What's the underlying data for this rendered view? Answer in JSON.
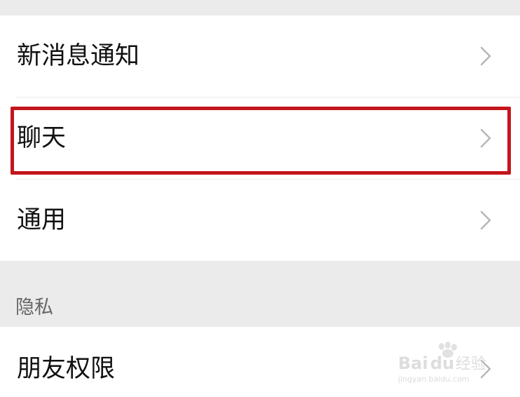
{
  "settings": {
    "rows": [
      {
        "label": "新消息通知",
        "icon": "chevron-right-icon"
      },
      {
        "label": "聊天",
        "icon": "chevron-right-icon",
        "highlighted": true
      },
      {
        "label": "通用",
        "icon": "chevron-right-icon"
      }
    ],
    "privacy_section": {
      "title": "隐私",
      "rows": [
        {
          "label": "朋友权限",
          "icon": "chevron-right-icon"
        }
      ]
    }
  },
  "annotation": {
    "highlight_color": "#c4151c"
  },
  "watermark": {
    "brand": "Baidu经验",
    "url": "jingyan.baidu.com"
  },
  "colors": {
    "section_background": "#ebebeb",
    "row_background": "#ffffff",
    "chevron": "#b5b5b5"
  }
}
